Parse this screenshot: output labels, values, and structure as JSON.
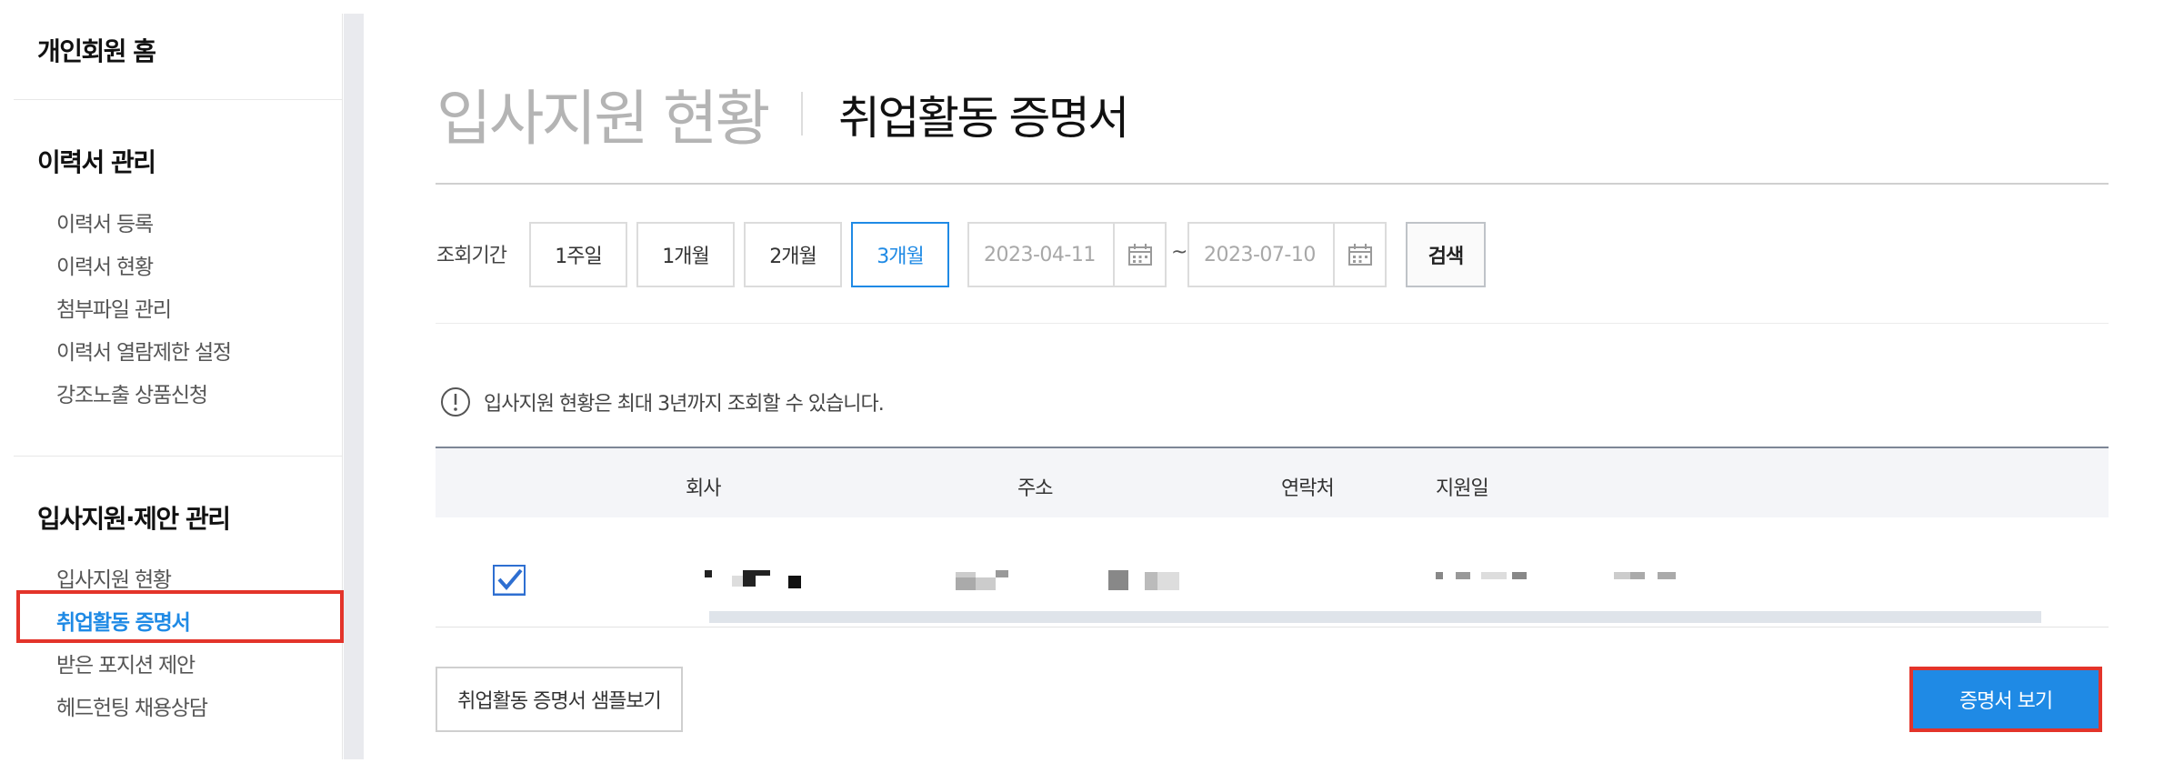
{
  "sidebar": {
    "home": "개인회원 홈",
    "sections": [
      {
        "title": "이력서 관리",
        "items": [
          "이력서 등록",
          "이력서 현황",
          "첨부파일 관리",
          "이력서 열람제한 설정",
          "강조노출 상품신청"
        ]
      },
      {
        "title": "입사지원·제안 관리",
        "items": [
          "입사지원 현황",
          "취업활동 증명서",
          "받은 포지션 제안",
          "헤드헌팅 채용상담"
        ]
      }
    ],
    "active_item": "취업활동 증명서"
  },
  "main": {
    "title": "입사지원 현황",
    "subtitle": "취업활동 증명서",
    "period_label": "조회기간",
    "period_buttons": [
      "1주일",
      "1개월",
      "2개월",
      "3개월"
    ],
    "selected_period": "3개월",
    "start_date": "2023-04-11",
    "end_date": "2023-07-10",
    "date_separator": "~",
    "search_label": "검색",
    "notice": "입사지원 현황은 최대 3년까지 조회할 수 있습니다.",
    "table": {
      "headers": [
        "회사",
        "주소",
        "연락처",
        "지원일"
      ],
      "rows": [
        {
          "checked": true
        }
      ]
    },
    "sample_button": "취업활동 증명서 샘플보기",
    "view_button": "증명서 보기"
  },
  "colors": {
    "accent": "#1f8ae5",
    "highlight": "#e3342a",
    "table_header_bg": "#f4f5f8"
  }
}
